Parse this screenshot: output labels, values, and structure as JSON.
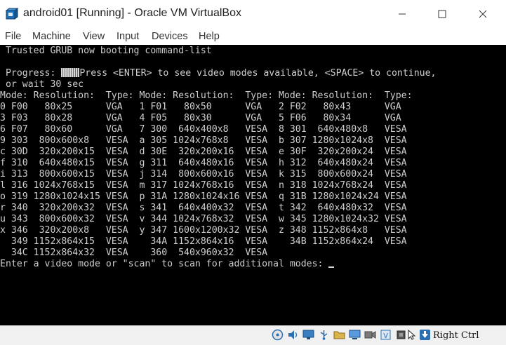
{
  "window": {
    "title": "android01 [Running] - Oracle VM VirtualBox",
    "controls": [
      "minimize",
      "maximize",
      "close"
    ]
  },
  "menu": {
    "items": [
      "File",
      "Machine",
      "View",
      "Input",
      "Devices",
      "Help"
    ]
  },
  "console": {
    "lines": [
      " Trusted GRUB now booting command-list",
      "",
      " Progress: ",
      " or wait 30 sec",
      "Mode: Resolution:  Type: Mode: Resolution:  Type: Mode: Resolution:  Type:",
      "0 F00   80x25      VGA   1 F01   80x50      VGA   2 F02   80x43      VGA",
      "3 F03   80x28      VGA   4 F05   80x30      VGA   5 F06   80x34      VGA",
      "6 F07   80x60      VGA   7 300  640x400x8   VESA  8 301  640x480x8   VESA",
      "9 303  800x600x8   VESA  a 305 1024x768x8   VESA  b 307 1280x1024x8  VESA",
      "c 30D  320x200x15  VESA  d 30E  320x200x16  VESA  e 30F  320x200x24  VESA",
      "f 310  640x480x15  VESA  g 311  640x480x16  VESA  h 312  640x480x24  VESA",
      "i 313  800x600x15  VESA  j 314  800x600x16  VESA  k 315  800x600x24  VESA",
      "l 316 1024x768x15  VESA  m 317 1024x768x16  VESA  n 318 1024x768x24  VESA",
      "o 319 1280x1024x15 VESA  p 31A 1280x1024x16 VESA  q 31B 1280x1024x24 VESA",
      "r 340  320x200x32  VESA  s 341  640x400x32  VESA  t 342  640x480x32  VESA",
      "u 343  800x600x32  VESA  v 344 1024x768x32  VESA  w 345 1280x1024x32 VESA",
      "x 346  320x200x8   VESA  y 347 1600x1200x32 VESA  z 348 1152x864x8   VESA",
      "  349 1152x864x15  VESA    34A 1152x864x16  VESA    34B 1152x864x24  VESA",
      "  34C 1152x864x32  VESA    360  540x960x32  VESA",
      "Enter a video mode or \"scan\" to scan for additional modes: "
    ],
    "progress_message": "Press <ENTER> to see video modes available, <SPACE> to continue,"
  },
  "statusbar": {
    "icons": [
      "optical-drive-icon",
      "audio-icon",
      "network-icon",
      "usb-icon",
      "shared-folders-icon",
      "display-icon",
      "recording-icon",
      "guest-additions-icon",
      "cpu-icon",
      "mouse-integration-icon",
      "keyboard-icon"
    ],
    "host_key": "Right Ctrl"
  }
}
